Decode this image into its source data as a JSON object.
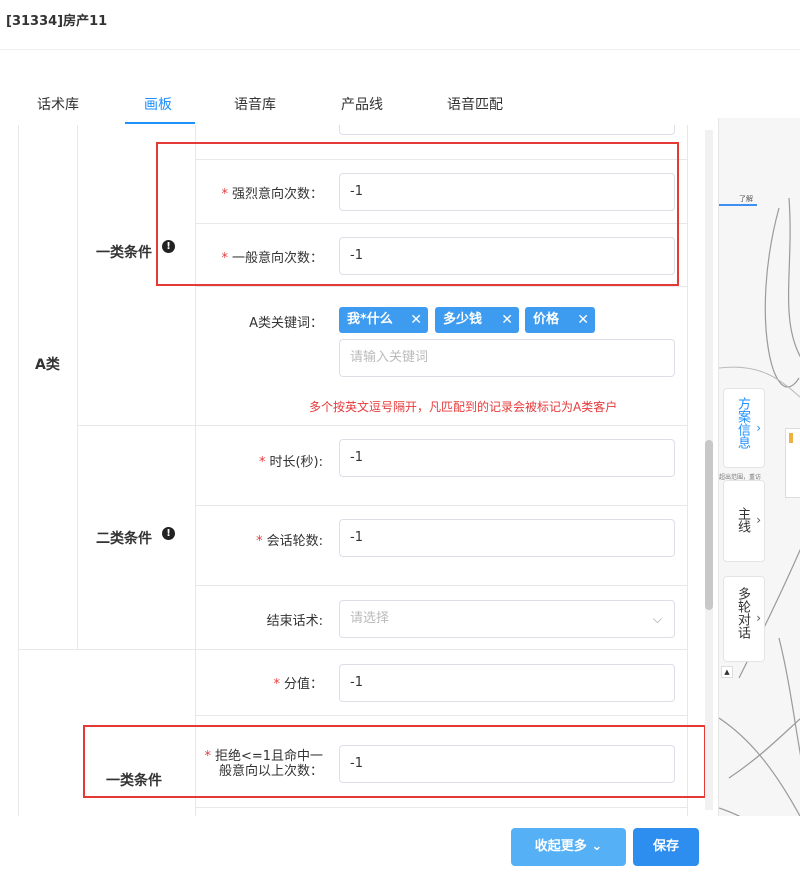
{
  "window": {
    "title": "[31334]房产11"
  },
  "tabs": [
    {
      "label": "话术库"
    },
    {
      "label": "画板"
    },
    {
      "label": "语音库"
    },
    {
      "label": "产品线"
    },
    {
      "label": "语音匹配"
    }
  ],
  "active_tab": "画板",
  "category_a": {
    "label": "A类",
    "cond1": {
      "label": "一类条件",
      "strong_intent": {
        "label": "强烈意向次数：",
        "value": "-1"
      },
      "normal_intent": {
        "label": "一般意向次数：",
        "value": "-1"
      },
      "keywords": {
        "label": "A类关键词：",
        "tags": [
          "我*什么",
          "多少钱",
          "价格"
        ],
        "placeholder": "请输入关键词",
        "hint": "多个按英文逗号隔开，凡匹配到的记录会被标记为A类客户"
      }
    },
    "cond2": {
      "label": "二类条件",
      "duration": {
        "label": "时长(秒):",
        "value": "-1"
      },
      "rounds": {
        "label": "会话轮数:",
        "value": "-1"
      },
      "end_script": {
        "label": "结束话术:",
        "placeholder": "请选择"
      }
    }
  },
  "category_b": {
    "score": {
      "label": "分值：",
      "value": "-1"
    },
    "cond1": {
      "label": "一类条件",
      "reject": {
        "label_line1": "拒绝<=1且命中一",
        "label_line2": "般意向以上次数：",
        "value": "-1"
      }
    }
  },
  "side_tabs": [
    {
      "label": "方案信息"
    },
    {
      "label": "主线"
    },
    {
      "label": "多轮对话"
    }
  ],
  "canvas_snippets": {
    "node_label": "了解",
    "note": "超出范围，重访"
  },
  "buttons": {
    "more": "收起更多",
    "save": "保存"
  },
  "colors": {
    "primary": "#2e8ef0",
    "tag": "#3d9cf0",
    "required": "#e63b3b",
    "highlight_box": "#e53935"
  }
}
